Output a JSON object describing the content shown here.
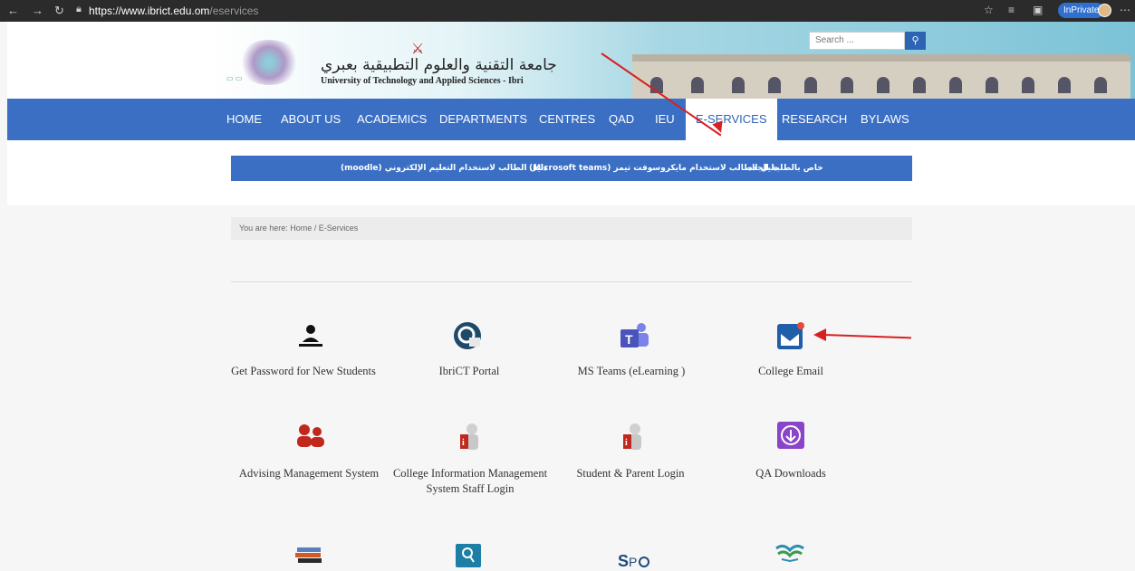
{
  "browser": {
    "url_host": "https://www.ibrict.edu.om",
    "url_path": "/eservices",
    "inprivate_label": "InPrivate"
  },
  "header": {
    "title_ar": "جامعة التقنية والعلوم التطبيقية بعبري",
    "title_en": "University of Technology and Applied Sciences - Ibri",
    "search_placeholder": "Search ..."
  },
  "menu": {
    "items": [
      "HOME",
      "ABOUT US",
      "ACADEMICS",
      "DEPARTMENTS",
      "CENTRES",
      "QAD",
      "IEU",
      "E-SERVICES",
      "RESEARCH",
      "BYLAWS"
    ],
    "active": "E-SERVICES"
  },
  "ar_links": [
    "خاص بالطلبة الجدد",
    "دليل الطالب لاستخدام مايكروسوفت تيمز (Microsoft teams)",
    "دليل الطالب لاستخدام التعليم الإلكتروني (moodle)"
  ],
  "breadcrumb": {
    "prefix": "You are here:",
    "home": "Home",
    "current": "E-Services"
  },
  "services": [
    {
      "label": "Get Password for New Students",
      "icon": "user-at-desk-icon"
    },
    {
      "label": "IbriCT Portal",
      "icon": "portal-icon"
    },
    {
      "label": "MS Teams (eLearning )",
      "icon": "teams-icon"
    },
    {
      "label": "College Email",
      "icon": "mail-icon"
    },
    {
      "label": "Advising Management System",
      "icon": "group-icon"
    },
    {
      "label": "College Information Management System Staff Login",
      "icon": "person-info-icon"
    },
    {
      "label": "Student & Parent Login",
      "icon": "person-info-icon"
    },
    {
      "label": "QA Downloads",
      "icon": "download-icon"
    },
    {
      "label": "",
      "icon": "books-icon"
    },
    {
      "label": "",
      "icon": "search-person-icon"
    },
    {
      "label": "",
      "icon": "sharepoint-icon"
    },
    {
      "label": "",
      "icon": "open-book-icon"
    }
  ],
  "colors": {
    "primary": "#3b6fc4",
    "arrow": "#d82020"
  }
}
